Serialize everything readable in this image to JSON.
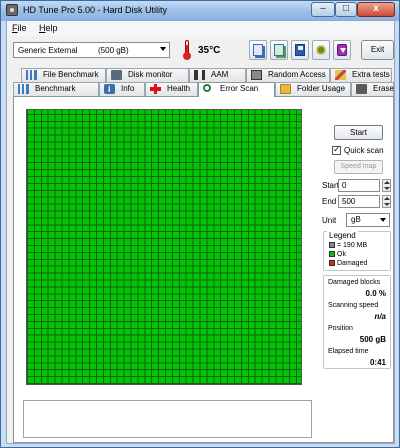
{
  "window": {
    "title": "HD Tune Pro 5.00 - Hard Disk Utility",
    "controls": {
      "minimize": "–",
      "maximize": "□",
      "close": "x"
    }
  },
  "menu": [
    {
      "label": "File"
    },
    {
      "label": "Help"
    }
  ],
  "toolbar": {
    "drive_name": "Generic External",
    "drive_size": "(500 gB)",
    "temperature": "35°C",
    "exit_label": "Exit",
    "icons": [
      "thermometer-icon",
      "copy-icon",
      "copy-all-icon",
      "save-icon",
      "options-icon",
      "download-icon"
    ]
  },
  "tabs": {
    "top_row": [
      "File Benchmark",
      "Disk monitor",
      "AAM",
      "Random Access",
      "Extra tests"
    ],
    "bottom_row": [
      "Benchmark",
      "Info",
      "Health",
      "Error Scan",
      "Folder Usage",
      "Erase"
    ],
    "active": "Error Scan"
  },
  "error_scan": {
    "start_button": "Start",
    "quick_scan_label": "Quick scan",
    "quick_scan_checked": true,
    "speed_map_button": "Speed map",
    "start_label": "Start",
    "start_value": "0",
    "end_label": "End",
    "end_value": "500",
    "unit_label": "Unit",
    "unit_value": "gB",
    "legend": {
      "title": "Legend",
      "block": "= 190 MB",
      "ok": "Ok",
      "damaged": "Damaged",
      "colors": {
        "ok": "#00c800",
        "damaged": "#d22222",
        "block": "#888888"
      }
    },
    "stats": {
      "damaged_label": "Damaged blocks",
      "damaged_value": "0.0 %",
      "speed_label": "Scanning speed",
      "speed_value": "n/a",
      "position_label": "Position",
      "position_value": "500 gB",
      "elapsed_label": "Elapsed time",
      "elapsed_value": "0:41"
    },
    "grid_status": "all blocks ok",
    "log_text": ""
  }
}
